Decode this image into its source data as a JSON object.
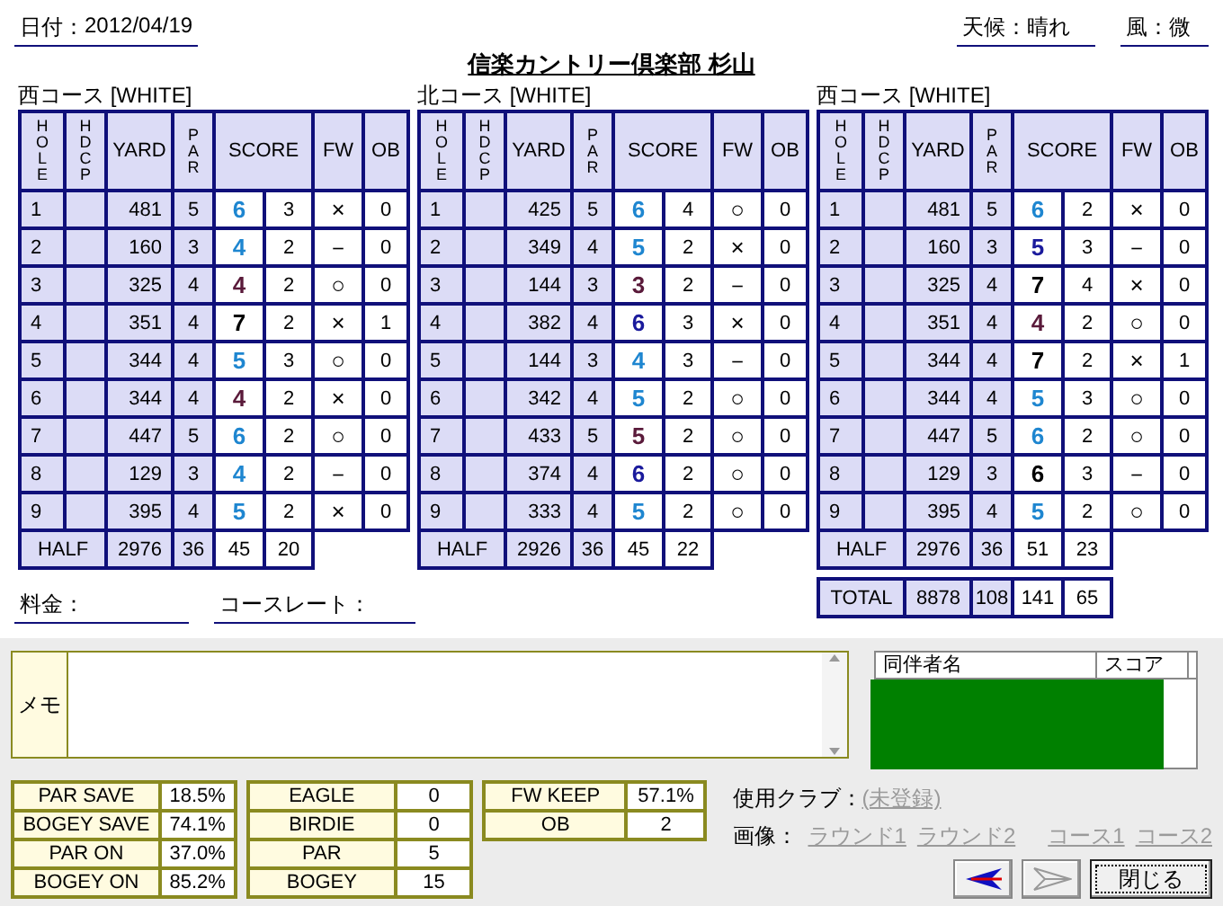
{
  "header": {
    "date_label": "日付：",
    "date": "2012/04/19",
    "weather_label": "天候：",
    "weather": "晴れ",
    "wind_label": "風：",
    "wind": "微"
  },
  "title": "信楽カントリー倶楽部 杉山",
  "cards": [
    {
      "course": "西コース [WHITE]",
      "columns": [
        "HOLE",
        "HDCP",
        "YARD",
        "PAR",
        "SCORE",
        "FW",
        "OB"
      ],
      "holes": [
        {
          "hole": "1",
          "yard": "481",
          "par": "5",
          "score": "6",
          "putts": "3",
          "fw": "×",
          "ob": "0",
          "color": "#1e86d0"
        },
        {
          "hole": "2",
          "yard": "160",
          "par": "3",
          "score": "4",
          "putts": "2",
          "fw": "－",
          "ob": "0",
          "color": "#1e86d0"
        },
        {
          "hole": "3",
          "yard": "325",
          "par": "4",
          "score": "4",
          "putts": "2",
          "fw": "○",
          "ob": "0",
          "color": "#5a1a3a"
        },
        {
          "hole": "4",
          "yard": "351",
          "par": "4",
          "score": "7",
          "putts": "2",
          "fw": "×",
          "ob": "1",
          "color": "#000000"
        },
        {
          "hole": "5",
          "yard": "344",
          "par": "4",
          "score": "5",
          "putts": "3",
          "fw": "○",
          "ob": "0",
          "color": "#1e86d0"
        },
        {
          "hole": "6",
          "yard": "344",
          "par": "4",
          "score": "4",
          "putts": "2",
          "fw": "×",
          "ob": "0",
          "color": "#5a1a3a"
        },
        {
          "hole": "7",
          "yard": "447",
          "par": "5",
          "score": "6",
          "putts": "2",
          "fw": "○",
          "ob": "0",
          "color": "#1e86d0"
        },
        {
          "hole": "8",
          "yard": "129",
          "par": "3",
          "score": "4",
          "putts": "2",
          "fw": "－",
          "ob": "0",
          "color": "#1e86d0"
        },
        {
          "hole": "9",
          "yard": "395",
          "par": "4",
          "score": "5",
          "putts": "2",
          "fw": "×",
          "ob": "0",
          "color": "#1e86d0"
        }
      ],
      "half": {
        "label": "HALF",
        "yard": "2976",
        "par": "36",
        "score": "45",
        "putts": "20"
      }
    },
    {
      "course": "北コース [WHITE]",
      "columns": [
        "HOLE",
        "HDCP",
        "YARD",
        "PAR",
        "SCORE",
        "FW",
        "OB"
      ],
      "holes": [
        {
          "hole": "1",
          "yard": "425",
          "par": "5",
          "score": "6",
          "putts": "4",
          "fw": "○",
          "ob": "0",
          "color": "#1e86d0"
        },
        {
          "hole": "2",
          "yard": "349",
          "par": "4",
          "score": "5",
          "putts": "2",
          "fw": "×",
          "ob": "0",
          "color": "#1e86d0"
        },
        {
          "hole": "3",
          "yard": "144",
          "par": "3",
          "score": "3",
          "putts": "2",
          "fw": "－",
          "ob": "0",
          "color": "#5a1a3a"
        },
        {
          "hole": "4",
          "yard": "382",
          "par": "4",
          "score": "6",
          "putts": "3",
          "fw": "×",
          "ob": "0",
          "color": "#1a1a9c"
        },
        {
          "hole": "5",
          "yard": "144",
          "par": "3",
          "score": "4",
          "putts": "3",
          "fw": "－",
          "ob": "0",
          "color": "#1e86d0"
        },
        {
          "hole": "6",
          "yard": "342",
          "par": "4",
          "score": "5",
          "putts": "2",
          "fw": "○",
          "ob": "0",
          "color": "#1e86d0"
        },
        {
          "hole": "7",
          "yard": "433",
          "par": "5",
          "score": "5",
          "putts": "2",
          "fw": "○",
          "ob": "0",
          "color": "#5a1a3a"
        },
        {
          "hole": "8",
          "yard": "374",
          "par": "4",
          "score": "6",
          "putts": "2",
          "fw": "○",
          "ob": "0",
          "color": "#1a1a9c"
        },
        {
          "hole": "9",
          "yard": "333",
          "par": "4",
          "score": "5",
          "putts": "2",
          "fw": "○",
          "ob": "0",
          "color": "#1e86d0"
        }
      ],
      "half": {
        "label": "HALF",
        "yard": "2926",
        "par": "36",
        "score": "45",
        "putts": "22"
      }
    },
    {
      "course": "西コース [WHITE]",
      "columns": [
        "HOLE",
        "HDCP",
        "YARD",
        "PAR",
        "SCORE",
        "FW",
        "OB"
      ],
      "holes": [
        {
          "hole": "1",
          "yard": "481",
          "par": "5",
          "score": "6",
          "putts": "2",
          "fw": "×",
          "ob": "0",
          "color": "#1e86d0"
        },
        {
          "hole": "2",
          "yard": "160",
          "par": "3",
          "score": "5",
          "putts": "3",
          "fw": "－",
          "ob": "0",
          "color": "#1a1a9c"
        },
        {
          "hole": "3",
          "yard": "325",
          "par": "4",
          "score": "7",
          "putts": "4",
          "fw": "×",
          "ob": "0",
          "color": "#000000"
        },
        {
          "hole": "4",
          "yard": "351",
          "par": "4",
          "score": "4",
          "putts": "2",
          "fw": "○",
          "ob": "0",
          "color": "#5a1a3a"
        },
        {
          "hole": "5",
          "yard": "344",
          "par": "4",
          "score": "7",
          "putts": "2",
          "fw": "×",
          "ob": "1",
          "color": "#000000"
        },
        {
          "hole": "6",
          "yard": "344",
          "par": "4",
          "score": "5",
          "putts": "3",
          "fw": "○",
          "ob": "0",
          "color": "#1e86d0"
        },
        {
          "hole": "7",
          "yard": "447",
          "par": "5",
          "score": "6",
          "putts": "2",
          "fw": "○",
          "ob": "0",
          "color": "#1e86d0"
        },
        {
          "hole": "8",
          "yard": "129",
          "par": "3",
          "score": "6",
          "putts": "3",
          "fw": "－",
          "ob": "0",
          "color": "#000000"
        },
        {
          "hole": "9",
          "yard": "395",
          "par": "4",
          "score": "5",
          "putts": "2",
          "fw": "○",
          "ob": "0",
          "color": "#1e86d0"
        }
      ],
      "half": {
        "label": "HALF",
        "yard": "2976",
        "par": "36",
        "score": "51",
        "putts": "23"
      },
      "total": {
        "label": "TOTAL",
        "yard": "8878",
        "par": "108",
        "score": "141",
        "putts": "65"
      }
    }
  ],
  "fees": [
    {
      "label": "料金："
    },
    {
      "label": "コースレート："
    }
  ],
  "memo": {
    "label": "メモ"
  },
  "stats": [
    [
      {
        "label": "PAR SAVE",
        "value": "18.5%"
      },
      {
        "label": "BOGEY SAVE",
        "value": "74.1%"
      },
      {
        "label": "PAR ON",
        "value": "37.0%"
      },
      {
        "label": "BOGEY ON",
        "value": "85.2%"
      }
    ],
    [
      {
        "label": "EAGLE",
        "value": "0"
      },
      {
        "label": "BIRDIE",
        "value": "0"
      },
      {
        "label": "PAR",
        "value": "5"
      },
      {
        "label": "BOGEY",
        "value": "15"
      }
    ],
    [
      {
        "label": "FW KEEP",
        "value": "57.1%"
      },
      {
        "label": "OB",
        "value": "2"
      }
    ]
  ],
  "companions": {
    "columns": [
      "同伴者名",
      "スコア"
    ]
  },
  "clubs": {
    "label": "使用クラブ：",
    "value": "(未登録)",
    "disabled": true
  },
  "images": {
    "label": "画像：",
    "links": [
      {
        "text": "ラウンド1",
        "disabled": true
      },
      {
        "text": "ラウンド2",
        "disabled": true
      },
      {
        "text": "コース1",
        "disabled": true
      },
      {
        "text": "コース2",
        "disabled": true
      }
    ]
  },
  "buttons": [
    {
      "kind": "back",
      "disabled": false
    },
    {
      "kind": "forward",
      "disabled": true
    },
    {
      "kind": "text",
      "label": "閉じる",
      "disabled": false
    }
  ]
}
